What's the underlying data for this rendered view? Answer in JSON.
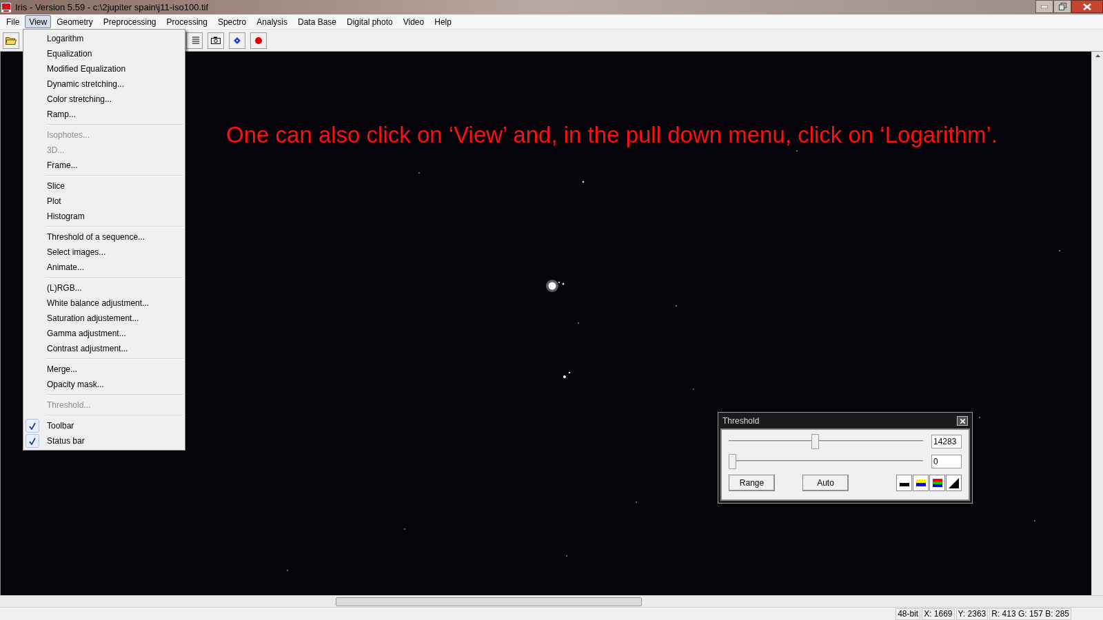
{
  "window": {
    "title": "Iris - Version 5.59 - c:\\2jupiter spain\\j11-iso100.tif"
  },
  "menu_bar": [
    {
      "label": "File",
      "selected": false
    },
    {
      "label": "View",
      "selected": true
    },
    {
      "label": "Geometry",
      "selected": false
    },
    {
      "label": "Preprocessing",
      "selected": false
    },
    {
      "label": "Processing",
      "selected": false
    },
    {
      "label": "Spectro",
      "selected": false
    },
    {
      "label": "Analysis",
      "selected": false
    },
    {
      "label": "Data Base",
      "selected": false
    },
    {
      "label": "Digital photo",
      "selected": false
    },
    {
      "label": "Video",
      "selected": false
    },
    {
      "label": "Help",
      "selected": false
    }
  ],
  "view_menu": [
    [
      {
        "label": "Logarithm",
        "disabled": false,
        "checked": false
      },
      {
        "label": "Equalization",
        "disabled": false,
        "checked": false
      },
      {
        "label": "Modified Equalization",
        "disabled": false,
        "checked": false
      },
      {
        "label": "Dynamic stretching...",
        "disabled": false,
        "checked": false
      },
      {
        "label": "Color stretching...",
        "disabled": false,
        "checked": false
      },
      {
        "label": "Ramp...",
        "disabled": false,
        "checked": false
      }
    ],
    [
      {
        "label": "Isophotes...",
        "disabled": true,
        "checked": false
      },
      {
        "label": "3D...",
        "disabled": true,
        "checked": false
      },
      {
        "label": "Frame...",
        "disabled": false,
        "checked": false
      }
    ],
    [
      {
        "label": "Slice",
        "disabled": false,
        "checked": false
      },
      {
        "label": "Plot",
        "disabled": false,
        "checked": false
      },
      {
        "label": "Histogram",
        "disabled": false,
        "checked": false
      }
    ],
    [
      {
        "label": "Threshold of a sequence...",
        "disabled": false,
        "checked": false
      },
      {
        "label": "Select images...",
        "disabled": false,
        "checked": false
      },
      {
        "label": "Animate...",
        "disabled": false,
        "checked": false
      }
    ],
    [
      {
        "label": "(L)RGB...",
        "disabled": false,
        "checked": false
      },
      {
        "label": "White balance adjustment...",
        "disabled": false,
        "checked": false
      },
      {
        "label": "Saturation adjustement...",
        "disabled": false,
        "checked": false
      },
      {
        "label": "Gamma adjustment...",
        "disabled": false,
        "checked": false
      },
      {
        "label": "Contrast adjustment...",
        "disabled": false,
        "checked": false
      }
    ],
    [
      {
        "label": "Merge...",
        "disabled": false,
        "checked": false
      },
      {
        "label": "Opacity mask...",
        "disabled": false,
        "checked": false
      }
    ],
    [
      {
        "label": "Threshold...",
        "disabled": true,
        "checked": false
      }
    ],
    [
      {
        "label": "Toolbar",
        "disabled": false,
        "checked": true
      },
      {
        "label": "Status bar",
        "disabled": false,
        "checked": true
      }
    ]
  ],
  "annotation": "One can also click on ‘View’ and, in the pull down menu, click on ‘Logarithm’.",
  "threshold_dialog": {
    "title": "Threshold",
    "sliders": [
      {
        "level": 0.44,
        "value": "14283"
      },
      {
        "level": 0,
        "value": "0"
      }
    ],
    "buttons": [
      "Range",
      "Auto"
    ]
  },
  "status_bar": [
    "48-bit",
    "X: 1669",
    "Y: 2363",
    "R: 413  G: 157  B: 285"
  ]
}
